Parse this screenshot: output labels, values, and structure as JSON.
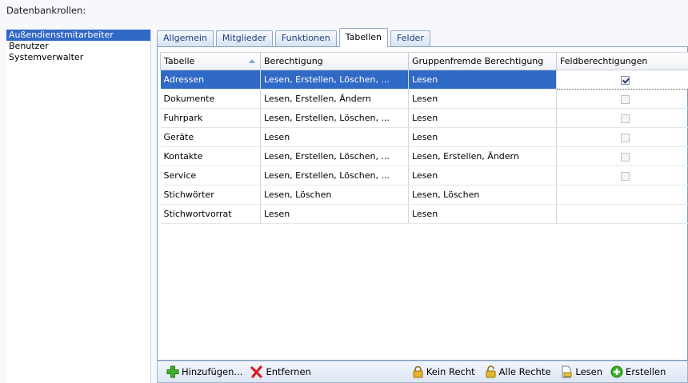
{
  "roles_label": "Datenbankrollen:",
  "roles": [
    {
      "label": "Außendienstmitarbeiter",
      "selected": true
    },
    {
      "label": "Benutzer",
      "selected": false
    },
    {
      "label": "Systemverwalter",
      "selected": false
    }
  ],
  "tabs": [
    {
      "label": "Allgemein",
      "active": false
    },
    {
      "label": "Mitglieder",
      "active": false
    },
    {
      "label": "Funktionen",
      "active": false
    },
    {
      "label": "Tabellen",
      "active": true
    },
    {
      "label": "Felder",
      "active": false
    }
  ],
  "grid": {
    "columns": [
      "Tabelle",
      "Berechtigung",
      "Gruppenfremde Berechtigung",
      "Feldberechtigungen"
    ],
    "sorted_column": "Tabelle",
    "rows": [
      {
        "table": "Adressen",
        "permission": "Lesen, Erstellen, Löschen, ...",
        "foreign": "Lesen",
        "field_perm": true,
        "has_checkbox": true,
        "selected": true
      },
      {
        "table": "Dokumente",
        "permission": "Lesen, Erstellen, Ändern",
        "foreign": "Lesen",
        "field_perm": false,
        "has_checkbox": true,
        "selected": false
      },
      {
        "table": "Fuhrpark",
        "permission": "Lesen, Erstellen, Löschen, ...",
        "foreign": "Lesen",
        "field_perm": false,
        "has_checkbox": true,
        "selected": false
      },
      {
        "table": "Geräte",
        "permission": "Lesen",
        "foreign": "Lesen",
        "field_perm": false,
        "has_checkbox": true,
        "selected": false
      },
      {
        "table": "Kontakte",
        "permission": "Lesen, Erstellen, Löschen, ...",
        "foreign": "Lesen, Erstellen, Ändern",
        "field_perm": false,
        "has_checkbox": true,
        "selected": false
      },
      {
        "table": "Service",
        "permission": "Lesen, Erstellen, Löschen, ...",
        "foreign": "Lesen",
        "field_perm": false,
        "has_checkbox": true,
        "selected": false
      },
      {
        "table": "Stichwörter",
        "permission": "Lesen, Löschen",
        "foreign": "Lesen, Löschen",
        "field_perm": false,
        "has_checkbox": false,
        "selected": false
      },
      {
        "table": "Stichwortvorrat",
        "permission": "Lesen",
        "foreign": "Lesen",
        "field_perm": false,
        "has_checkbox": false,
        "selected": false
      }
    ]
  },
  "toolbar": {
    "add_label": "Hinzufügen...",
    "remove_label": "Entfernen",
    "no_right_label": "Kein Recht",
    "all_rights_label": "Alle Rechte",
    "read_label": "Lesen",
    "create_label": "Erstellen"
  },
  "colors": {
    "selection": "#3169c6",
    "add_icon": "#3fae2a",
    "remove_icon": "#d42020",
    "lock_icon": "#d9a520"
  }
}
